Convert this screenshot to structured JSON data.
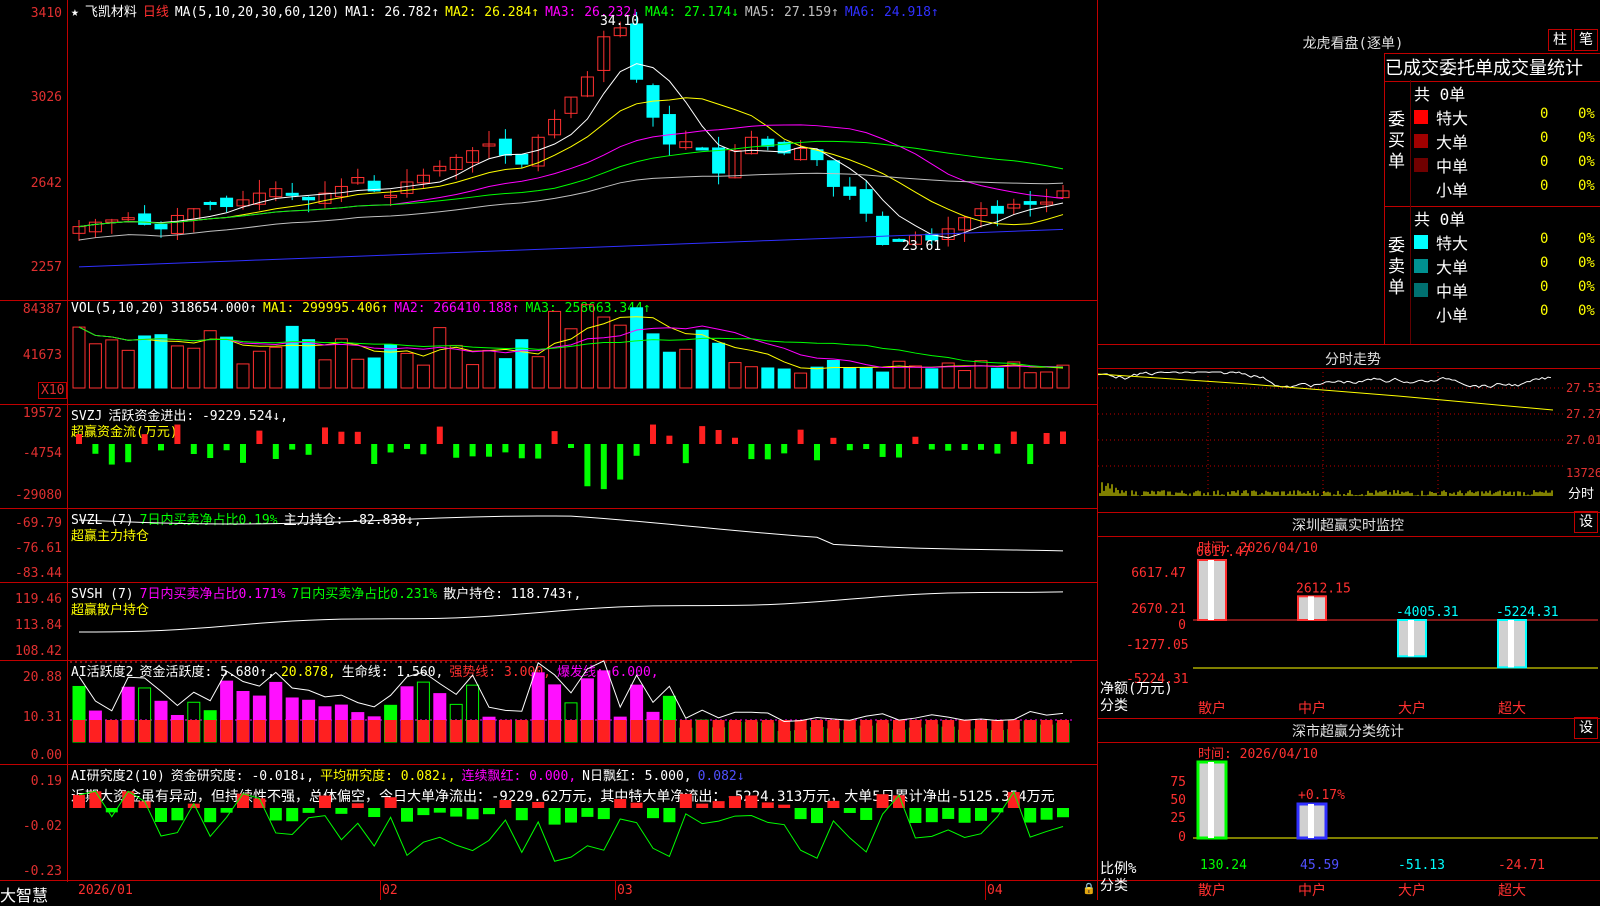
{
  "app": {
    "brand": "大智慧"
  },
  "main_chart": {
    "stock_name": "飞凯材料",
    "period": "日线",
    "ma_label": "MA(5,10,20,30,60,120)",
    "ma": [
      {
        "label": "MA1: 26.782↑",
        "color": "#ffffff"
      },
      {
        "label": "MA2: 26.284↑",
        "color": "#ffff00"
      },
      {
        "label": "MA3: 26.232↓",
        "color": "#ff00ff"
      },
      {
        "label": "MA4: 27.174↓",
        "color": "#00ff00"
      },
      {
        "label": "MA5: 27.159↑",
        "color": "#c0c0c0"
      },
      {
        "label": "MA6: 24.918↑",
        "color": "#3030ff"
      }
    ],
    "y_ticks": [
      "3410",
      "3026",
      "2642",
      "2257"
    ],
    "high_label": "34.10",
    "low_label": "23.61"
  },
  "vol_panel": {
    "title": "VOL(5,10,20)",
    "value": "318654.000↑",
    "ma1": "MA1: 299995.406↑",
    "ma2": "MA2: 266410.188↑",
    "ma3": "MA3: 258663.344↑",
    "y_ticks": [
      "84387",
      "41673"
    ],
    "unit": "X10"
  },
  "svzj_panel": {
    "title": "SVZJ",
    "label": "活跃资金进出: -9229.524↓,",
    "subtitle": "超赢资金流(万元)",
    "y_ticks": [
      "19572",
      "-4754",
      "-29080"
    ]
  },
  "svzl_panel": {
    "title": "SVZL (7)",
    "label1": "7日内买卖净占比0.19%",
    "label2": "主力持仓: -82.838↓,",
    "subtitle": "超赢主力持仓",
    "y_ticks": [
      "-69.79",
      "-76.61",
      "-83.44"
    ]
  },
  "svsh_panel": {
    "title": "SVSH (7)",
    "label1": "7日内买卖净占比0.171%",
    "label2": "7日内买卖净占比0.231%",
    "label3": "散户持仓: 118.743↑,",
    "subtitle": "超赢散户持仓",
    "y_ticks": [
      "119.46",
      "113.84",
      "108.42"
    ]
  },
  "ai_active_panel": {
    "title": "AI活跃度2",
    "label1": "资金活跃度: 5.680↑,",
    "label2": "20.878,",
    "label3": "生命线: 1.560,",
    "label4": "强势线: 3.000,",
    "label5": "爆发线: 6.000,",
    "y_ticks": [
      "20.88",
      "10.31",
      "0.00"
    ]
  },
  "ai_research_panel": {
    "title": "AI研究度2(10)",
    "label1": "资金研究度: -0.018↓,",
    "label2": "平均研究度: 0.082↓,",
    "label3": "连续飘红: 0.000,",
    "label4": "N日飘红: 5.000,",
    "label5": "0.082↓",
    "comment": "近期大资金虽有异动，但持续性不强，总体偏空，今日大单净流出：-9229.62万元，其中特大单净流出：-5224.313万元，大单5日累计净出-5125.354万元",
    "y_ticks": [
      "0.19",
      "-0.02",
      "-0.23"
    ]
  },
  "x_axis": {
    "labels": [
      "2026/01",
      "02",
      "03",
      "04"
    ]
  },
  "dragon_tiger": {
    "title": "龙虎看盘(逐单)",
    "btn_bar": "柱",
    "btn_pen": "笔",
    "tabs": [
      "已成交",
      "委托单",
      "成交量统计"
    ],
    "buy_label": "委买单",
    "sell_label": "委卖单",
    "buy_total": "共 0单",
    "sell_total": "共 0单",
    "buy_rows": [
      {
        "name": "特大",
        "count": "0",
        "pct": "0%",
        "color": "#ff0000"
      },
      {
        "name": "大单",
        "count": "0",
        "pct": "0%",
        "color": "#a00000"
      },
      {
        "name": "中单",
        "count": "0",
        "pct": "0%",
        "color": "#700000"
      },
      {
        "name": "小单",
        "count": "0",
        "pct": "0%",
        "color": ""
      }
    ],
    "sell_rows": [
      {
        "name": "特大",
        "count": "0",
        "pct": "0%",
        "color": "#00ffff"
      },
      {
        "name": "大单",
        "count": "0",
        "pct": "0%",
        "color": "#009090"
      },
      {
        "name": "中单",
        "count": "0",
        "pct": "0%",
        "color": "#007070"
      },
      {
        "name": "小单",
        "count": "0",
        "pct": "0%",
        "color": ""
      }
    ]
  },
  "intraday": {
    "title": "分时走势",
    "y_ticks": [
      "27.53",
      "27.27",
      "27.01"
    ],
    "vol_label": "13726",
    "footer": "分时"
  },
  "sz_monitor": {
    "title": "深圳超赢实时监控",
    "settings": "设",
    "time": "时间: 2026/04/10",
    "y_ticks": [
      "6617.47",
      "2670.21",
      "0",
      "-1277.05",
      "-5224.31"
    ],
    "y_label": "净额(万元)",
    "x_label": "分类",
    "categories": [
      "散户",
      "中户",
      "大户",
      "超大"
    ],
    "values": [
      6617.47,
      2612.15,
      -4005.31,
      -5224.31
    ],
    "value_labels": [
      "6617.47",
      "2612.15",
      "-4005.31",
      "-5224.31"
    ]
  },
  "sz_category": {
    "title": "深市超赢分类统计",
    "settings": "设",
    "time": "时间: 2026/04/10",
    "y_ticks": [
      "75",
      "50",
      "25",
      "0"
    ],
    "y_label": "比例%",
    "x_label": "分类",
    "categories": [
      "散户",
      "中户",
      "大户",
      "超大"
    ],
    "values": [
      "130.24",
      "45.59",
      "-51.13",
      "-24.71"
    ],
    "annotation": "+0.17%"
  }
}
